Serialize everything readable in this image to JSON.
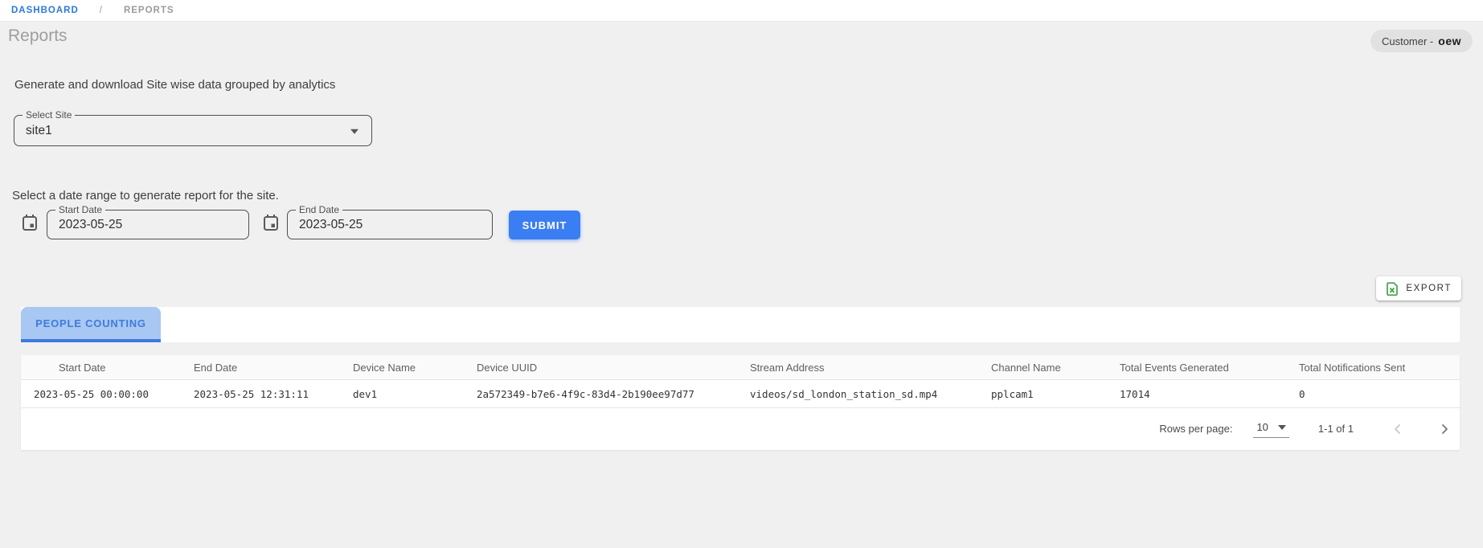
{
  "breadcrumb": {
    "separator": "/",
    "items": [
      {
        "label": "DASHBOARD"
      },
      {
        "label": "REPORTS"
      }
    ]
  },
  "page": {
    "title": "Reports"
  },
  "customer_badge": {
    "prefix": "Customer -",
    "name": "oew"
  },
  "intro": "Generate and download Site wise data grouped by analytics",
  "site_select": {
    "label": "Select Site",
    "value": "site1"
  },
  "date_section": {
    "instruction": "Select a date range to generate report for the site.",
    "start": {
      "label": "Start Date",
      "value": "2023-05-25"
    },
    "end": {
      "label": "End Date",
      "value": "2023-05-25"
    },
    "submit_label": "SUBMIT"
  },
  "export_button": {
    "label": "EXPORT"
  },
  "tabs": [
    {
      "label": "PEOPLE COUNTING",
      "active": true
    }
  ],
  "table": {
    "headers": [
      "Start Date",
      "End Date",
      "Device Name",
      "Device UUID",
      "Stream Address",
      "Channel Name",
      "Total Events Generated",
      "Total Notifications Sent"
    ],
    "rows": [
      [
        "2023-05-25 00:00:00",
        "2023-05-25 12:31:11",
        "dev1",
        "2a572349-b7e6-4f9c-83d4-2b190ee97d77",
        "videos/sd_london_station_sd.mp4",
        "pplcam1",
        "17014",
        "0"
      ]
    ],
    "pagination": {
      "rows_per_page_label": "Rows per page:",
      "rows_per_page_value": "10",
      "range_label": "1-1 of 1"
    }
  },
  "icons": {
    "calendar": "calendar-icon",
    "excel": "excel-file-icon",
    "select_caret": "chevron-down-icon",
    "prev": "chevron-left-icon",
    "next": "chevron-right-icon"
  },
  "colors": {
    "accent_blue": "#3b7df2",
    "breadcrumb_blue": "#2a79dd",
    "tab_blue": "#3d7cdb",
    "tab_bg": "#a8c7f2",
    "excel_green": "#43a047",
    "page_bg": "#f0f0f0"
  }
}
